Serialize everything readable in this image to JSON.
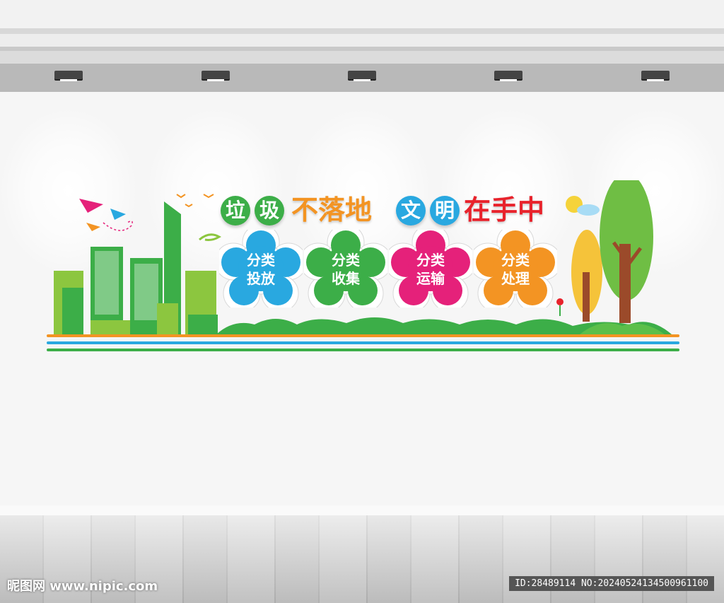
{
  "title": {
    "part1": [
      "垃",
      "圾"
    ],
    "part2": "不落地",
    "part3": [
      "文",
      "明"
    ],
    "part4": "在手中"
  },
  "flowers": [
    {
      "line1": "分类",
      "line2": "投放",
      "color": "#29a8e0"
    },
    {
      "line1": "分类",
      "line2": "收集",
      "color": "#3cae48"
    },
    {
      "line1": "分类",
      "line2": "运输",
      "color": "#e5217a"
    },
    {
      "line1": "分类",
      "line2": "处理",
      "color": "#f39423"
    }
  ],
  "colors": {
    "green": "#3cae48",
    "orange": "#f39423",
    "blue": "#29a8e0",
    "red": "#e8232c"
  },
  "watermark": {
    "left": "昵图网 www.nipic.com",
    "right": "ID:28489114 NO:20240524134500961100"
  }
}
